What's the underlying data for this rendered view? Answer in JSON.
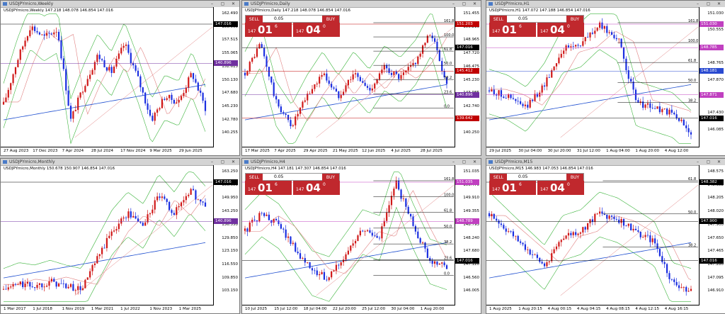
{
  "windows": [
    {
      "id": "weekly",
      "title": "USDJPYmicro,Weekly",
      "info": "USDJPYmicro,Weekly  147.218 148.078 146.854 147.016",
      "price_labels": [
        "162.490",
        "159.965",
        "157.515",
        "155.065",
        "152.615",
        "150.130",
        "147.680",
        "145.230",
        "142.780",
        "140.255"
      ],
      "tags": [
        {
          "text": "147.016",
          "type": "black"
        },
        {
          "text": "140.896",
          "type": "purple"
        }
      ],
      "xlabels": [
        "27 Aug 2023",
        "17 Dec 2023",
        "7 Apr 2024",
        "28 Jul 2024",
        "17 Nov 2024",
        "9 Mar 2025",
        "29 Jun 2025"
      ],
      "trade": null
    },
    {
      "id": "daily",
      "title": "USDJPYmicro,Daily",
      "info": "USDJPYmicro,Daily  147.218 148.078 146.854 147.016",
      "price_labels": [
        "151.455",
        "150.210",
        "148.965",
        "147.720",
        "146.475",
        "145.230",
        "143.985",
        "142.740",
        "141.495",
        "140.250"
      ],
      "tags": [
        {
          "text": "151.203",
          "type": "red"
        },
        {
          "text": "147.016",
          "type": "black"
        },
        {
          "text": "145.412",
          "type": "red"
        },
        {
          "text": "140.896",
          "type": "purple"
        },
        {
          "text": "139.642",
          "type": "red"
        }
      ],
      "fib": [
        "161.8",
        "100.0",
        "61.8",
        "50.0",
        "38.2",
        "23.6",
        "0.0"
      ],
      "xlabels": [
        "17 Mar 2025",
        "7 Apr 2025",
        "29 Apr 2025",
        "21 May 2025",
        "12 Jun 2025",
        "4 Jul 2025",
        "28 Jul 2025"
      ],
      "trade": {
        "sell": "SELL",
        "buy": "BUY",
        "volume": "0.05",
        "bid_small": "147",
        "bid_big": "01",
        "bid_sup": "6",
        "ask_small": "147",
        "ask_big": "04",
        "ask_sup": "0"
      }
    },
    {
      "id": "h1",
      "title": "USDJPYmicro,H1",
      "info": "USDJPYmicro,H1  147.072 147.188 146.854 147.016",
      "price_labels": [
        "151.030",
        "150.555",
        "149.660",
        "148.765",
        "147.870",
        "146.975",
        "147.430",
        "146.085"
      ],
      "tags": [
        {
          "text": "151.030",
          "type": "pink"
        },
        {
          "text": "148.785",
          "type": "pink"
        },
        {
          "text": "148.181",
          "type": "blue"
        },
        {
          "text": "147.871",
          "type": "pink"
        },
        {
          "text": "147.016",
          "type": "black"
        }
      ],
      "fib": [
        "161.8",
        "100.0",
        "61.8",
        "50.0",
        "38.2"
      ],
      "xlabels": [
        "29 Jul 2025",
        "30 Jul 04:00",
        "30 Jul 20:00",
        "31 Jul 12:00",
        "1 Aug 04:00",
        "1 Aug 20:00",
        "4 Aug 12:00"
      ],
      "trade": {
        "sell": "SELL",
        "buy": "BUY",
        "volume": "0.05",
        "bid_small": "147",
        "bid_big": "01",
        "bid_sup": "6",
        "ask_small": "147",
        "ask_big": "04",
        "ask_sup": "0"
      }
    },
    {
      "id": "monthly",
      "title": "USDJPYmicro,Monthly",
      "info": "USDJPYmicro,Monthly  150.678 150.907 146.854 147.016",
      "price_labels": [
        "163.250",
        "156.650",
        "149.950",
        "143.250",
        "136.550",
        "129.850",
        "123.150",
        "116.550",
        "109.850",
        "103.150"
      ],
      "tags": [
        {
          "text": "147.016",
          "type": "black"
        },
        {
          "text": "140.896",
          "type": "purple"
        }
      ],
      "xlabels": [
        "1 Mar 2017",
        "1 Jul 2018",
        "1 Nov 2019",
        "1 Mar 2021",
        "1 Jul 2022",
        "1 Nov 2023",
        "1 Mar 2025"
      ],
      "trade": null
    },
    {
      "id": "h4",
      "title": "USDJPYmicro,H4",
      "info": "USDJPYmicro,H4  147.181 147.307 146.854 147.016",
      "price_labels": [
        "151.035",
        "150.470",
        "149.910",
        "149.355",
        "148.795",
        "148.240",
        "147.680",
        "147.120",
        "146.560",
        "146.005"
      ],
      "tags": [
        {
          "text": "151.035",
          "type": "pink"
        },
        {
          "text": "148.789",
          "type": "pink"
        },
        {
          "text": "147.016",
          "type": "black"
        }
      ],
      "fib": [
        "161.8",
        "100.0",
        "61.8",
        "50.0",
        "38.2",
        "23.6",
        "0.0"
      ],
      "xlabels": [
        "10 Jul 2025",
        "15 Jul 12:00",
        "18 Jul 04:00",
        "22 Jul 20:00",
        "25 Jul 12:00",
        "30 Jul 04:00",
        "1 Aug 20:00"
      ],
      "trade": {
        "sell": "SELL",
        "buy": "BUY",
        "volume": "0.05",
        "bid_small": "147",
        "bid_big": "01",
        "bid_sup": "6",
        "ask_small": "147",
        "ask_big": "04",
        "ask_sup": "0"
      }
    },
    {
      "id": "m15",
      "title": "USDJPYmicro,M15",
      "info": "USDJPYmicro,M15  146.983 147.053 146.854 147.016",
      "price_labels": [
        "148.575",
        "148.382",
        "148.205",
        "148.020",
        "147.900",
        "147.650",
        "147.465",
        "147.280",
        "147.095",
        "146.910"
      ],
      "tags": [
        {
          "text": "148.382",
          "type": "black"
        },
        {
          "text": "147.900",
          "type": "black"
        },
        {
          "text": "147.016",
          "type": "black"
        }
      ],
      "fib": [
        "61.8",
        "50.0",
        "38.2"
      ],
      "xlabels": [
        "1 Aug 2025",
        "1 Aug 20:15",
        "4 Aug 00:15",
        "4 Aug 04:15",
        "4 Aug 08:15",
        "4 Aug 12:15",
        "4 Aug 16:15"
      ],
      "trade": {
        "sell": "SELL",
        "buy": "BUY",
        "volume": "0.05",
        "bid_small": "147",
        "bid_big": "01",
        "bid_sup": "6",
        "ask_small": "147",
        "ask_big": "04",
        "ask_sup": "0"
      }
    }
  ],
  "window_buttons": {
    "minimize": "–",
    "restore": "▢",
    "close": "✕"
  },
  "colors": {
    "bull": "#d01818",
    "bear": "#1a2ee0",
    "bb": "#3cb43c",
    "ma_blue": "#2050d0",
    "ma_red": "#e08080",
    "pink_line": "#d050d0",
    "tag_red": "#c00000",
    "tag_purple": "#7030a0",
    "tag_pink": "#c040c0",
    "tag_blue": "#2a4ad0",
    "trade_red": "#c0282d"
  }
}
